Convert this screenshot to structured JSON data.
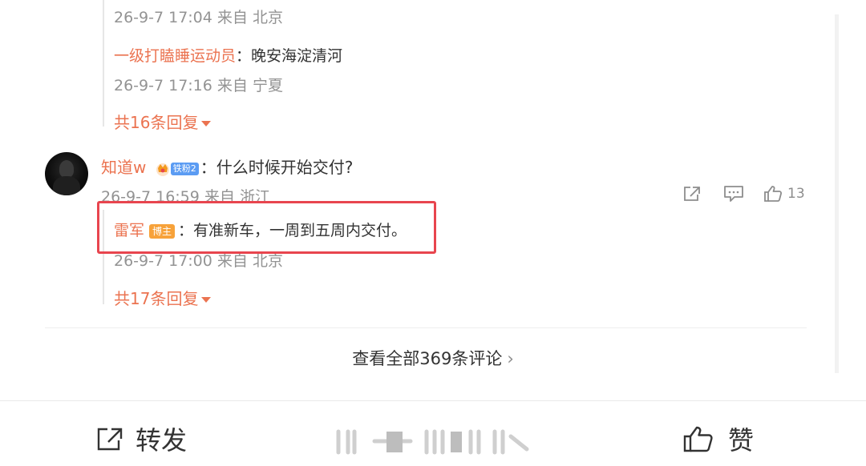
{
  "top_thread": {
    "prev_meta": "26-9-7 17:04 来自 北京",
    "reply": {
      "user": "一级打瞌睡运动员",
      "separator": "：",
      "text": "晚安海淀清河"
    },
    "reply_meta": "26-9-7 17:16 来自 宁夏",
    "more_replies": "共16条回复"
  },
  "comment": {
    "user": "知道w",
    "fan_badge": "铁粉2",
    "separator": "：",
    "text": "什么时候开始交付?",
    "meta": "26-9-7 16:59 来自 浙江",
    "like_count": "13",
    "icons": [
      "share-icon",
      "comment-icon",
      "like-icon"
    ],
    "reply": {
      "user": "雷军",
      "badge": "博主",
      "separator": "：",
      "text": "有准新车，一周到五周内交付。"
    },
    "reply_meta": "26-9-7 17:00 来自 北京",
    "more_replies": "共17条回复"
  },
  "view_all": {
    "label": "查看全部369条评论",
    "chevron": "›"
  },
  "bottom_bar": {
    "repost_label": "转发",
    "like_label": "赞"
  },
  "colors": {
    "username": "#eb7350",
    "highlight": "#e8454e",
    "meta": "#939393",
    "fan_badge": "#5b9cf3",
    "blogger_badge": "#f7a23a"
  }
}
